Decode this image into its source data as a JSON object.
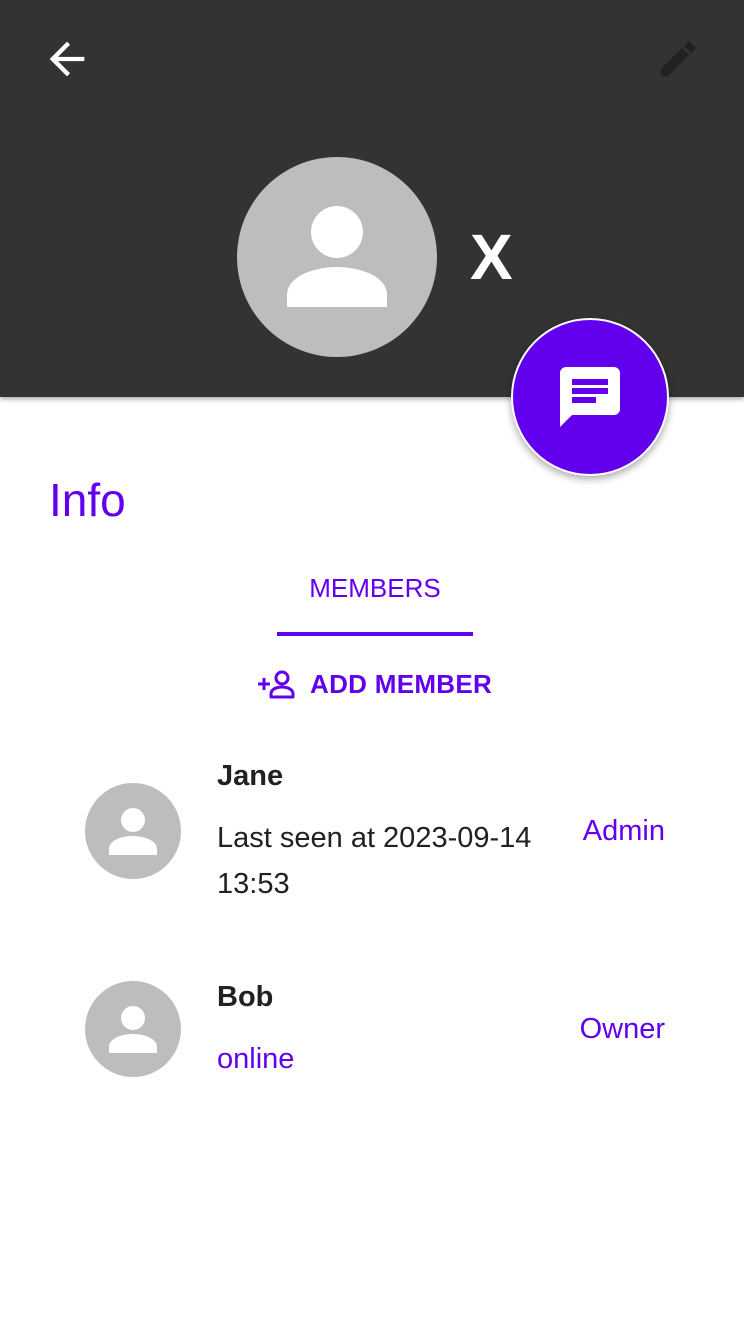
{
  "header": {
    "group_name": "X",
    "back_icon": "arrow-back-icon",
    "edit_icon": "pencil-icon",
    "avatar_icon": "person-icon",
    "background_color": "#333333"
  },
  "fab": {
    "icon": "chat-icon",
    "color": "#6200ee"
  },
  "info": {
    "title": "Info"
  },
  "tabs": [
    {
      "label": "MEMBERS",
      "active": true
    }
  ],
  "actions": {
    "add_member_label": "ADD MEMBER",
    "add_member_icon": "add-person-icon"
  },
  "members": [
    {
      "name": "Jane",
      "status": "Last seen at 2023-09-14 13:53",
      "role": "Admin",
      "online": false
    },
    {
      "name": "Bob",
      "status": "online",
      "role": "Owner",
      "online": true
    }
  ],
  "colors": {
    "accent": "#6200ee",
    "avatar_gray": "#bdbdbd",
    "text": "#212121"
  }
}
